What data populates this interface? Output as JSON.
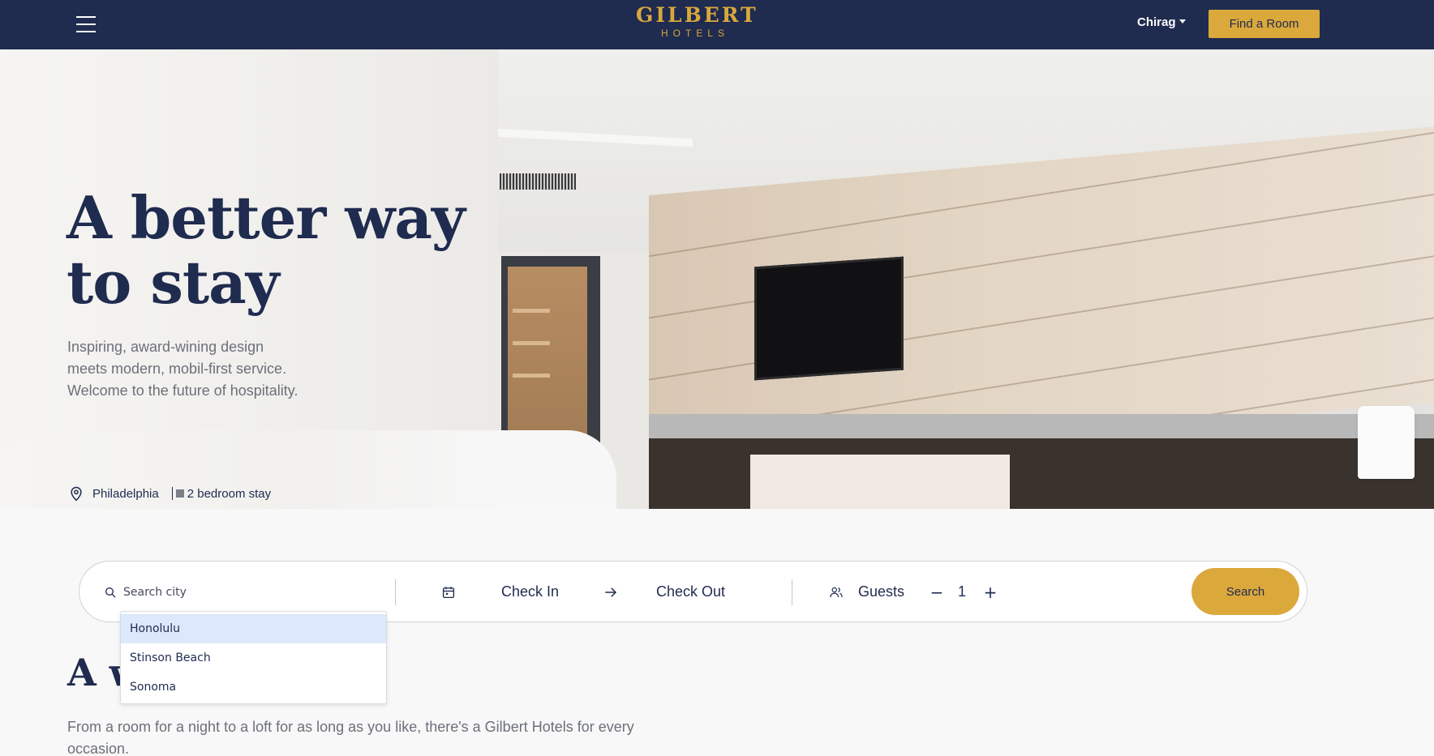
{
  "header": {
    "menu_icon": "hamburger-icon",
    "brand_name": "GILBERT",
    "brand_sub": "HOTELS",
    "user_name": "Chirag",
    "cta_label": "Find a Room"
  },
  "hero": {
    "title_line1": "A better way",
    "title_line2": "to stay",
    "subtitle_line1": "Inspiring, award-wining design",
    "subtitle_line2": "meets modern, mobil-first service.",
    "subtitle_line3": "Welcome to the future of hospitality.",
    "location": "Philadelphia",
    "stay_type": "2 bedroom stay"
  },
  "search": {
    "placeholder": "Search city",
    "value": "",
    "check_in": "Check In",
    "check_out": "Check Out",
    "guests_label": "Guests",
    "guest_count": "1",
    "decrement": "−",
    "increment": "+",
    "button_label": "Search",
    "suggestions": [
      "Honolulu",
      "Stinson Beach",
      "Sonoma"
    ]
  },
  "section": {
    "title_visible": "A w",
    "body": "From a room for a night to a loft for as long as you like, there's a Gilbert Hotels for every occasion."
  },
  "colors": {
    "navy": "#1f2b4f",
    "gold": "#dba83c",
    "highlight": "#dce8fb"
  }
}
